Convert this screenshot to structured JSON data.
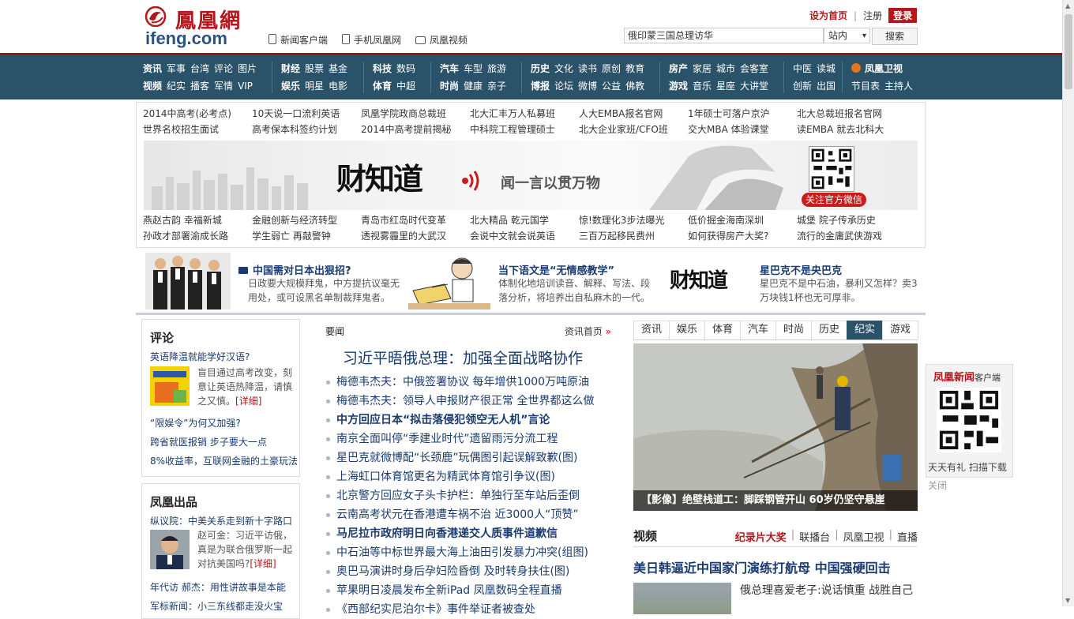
{
  "header": {
    "logo_cn": "鳳凰網",
    "logo_en": "ifeng.com",
    "top_links": [
      "新闻客户端",
      "手机凤凰网",
      "凤凰视频"
    ],
    "set_home": "设为首页",
    "register": "注册",
    "login": "登录",
    "search_value": "俄印蒙三国总理访华",
    "search_scope": "站内",
    "search_button": "搜索"
  },
  "nav": {
    "groups": [
      {
        "rows": [
          [
            "资讯",
            "军事",
            "台湾",
            "评论",
            "图片"
          ],
          [
            "视频",
            "纪实",
            "播客",
            "军情",
            "VIP"
          ]
        ]
      },
      {
        "rows": [
          [
            "财经",
            "股票",
            "基金"
          ],
          [
            "娱乐",
            "明星",
            "电影"
          ]
        ]
      },
      {
        "rows": [
          [
            "科技",
            "数码"
          ],
          [
            "体育",
            "中超"
          ]
        ]
      },
      {
        "rows": [
          [
            "汽车",
            "车型",
            "旅游"
          ],
          [
            "时尚",
            "健康",
            "亲子"
          ]
        ]
      },
      {
        "rows": [
          [
            "历史",
            "文化",
            "读书",
            "原创",
            "教育"
          ],
          [
            "博报",
            "论坛",
            "微博",
            "公益",
            "佛教"
          ]
        ]
      },
      {
        "rows": [
          [
            "房产",
            "家居",
            "城市",
            "会客室"
          ],
          [
            "游戏",
            "音乐",
            "星座",
            "大讲堂"
          ]
        ]
      },
      {
        "rows": [
          [
            "中医",
            "读城"
          ],
          [
            "创新",
            "出国"
          ]
        ]
      },
      {
        "rows": [
          [
            "凤凰卫视"
          ],
          [
            "节目表",
            "主持人"
          ]
        ]
      }
    ]
  },
  "ad": {
    "links_top": [
      "2014中高考(必考点)",
      "10天说一口流利英语",
      "凤凰学院政商总裁班",
      "北大汇丰万人私募班",
      "人大EMBA报名官网",
      "1年硕士可落户京沪",
      "北大总裁班报名官网",
      "世界名校招生面试",
      "高考保本科签约计划",
      "2014中高考提前揭秘",
      "中科院工程管理硕士",
      "北大企业家班/CFO班",
      "交大MBA 体验课堂",
      "读EMBA 就去北科大"
    ],
    "banner_logo": "财知道",
    "banner_slogan": "闻一言以贯万物",
    "banner_follow": "关注官方微信",
    "links_bottom": [
      "燕赵古韵 幸福新城",
      "金融创新与经济转型",
      "青岛市红岛时代变革",
      "北大精品 乾元国学",
      "惊!数理化3步法曝光",
      "低价掘金海南深圳",
      "城堡 院子传承历史",
      "孙政才部署渝成长路",
      "学生弱亡 再敲警钟",
      "透视雾霾里的大武汉",
      "会说中文就会说英语",
      "三百万起移民费州",
      "如何获得房产大奖?",
      "流行的金庸武侠游戏"
    ]
  },
  "features": [
    {
      "title": "中国需对日本出狠招?",
      "desc": "日政要大规模拜鬼，中方提抗议毫无用处，或可设黑名单制裁拜鬼者。"
    },
    {
      "title": "当下语文是“无情感教学”",
      "desc": "体制化地培训读音、解释、写法、段落分析，将培养出自私麻木的一代。"
    },
    {
      "title": "星巴克不是央巴克",
      "desc": "星巴克不是中石油，暴利又怎样？卖3万块钱1杯也无可厚非。"
    }
  ],
  "feature_logo": "财知道",
  "comment": {
    "title": "评论",
    "lead": "英语降温就能学好汉语?",
    "desc": "盲目通过高考改变，刻意让英语热降温，请慎之又慎。",
    "more": "[详细]",
    "links": [
      "“限娱令”为何又加强?",
      "跨省就医报销 步子要大一点",
      "8%收益率，互联网金融的土豪玩法"
    ]
  },
  "produce": {
    "title": "凤凰出品",
    "lead": "纵议院：中美关系走到新十字路口",
    "desc": "赵可金：习近平访俄，真是为联合俄罗斯一起对抗美国吗?",
    "more": "[详细]",
    "links": [
      "年代访 郝杰：用性讲故事是本能",
      "军标新闻：小三东线都走没火宝"
    ]
  },
  "center": {
    "tab_label": "要闻",
    "more_label": "资讯首页",
    "more_arrow": "»",
    "headline": "习近平晤俄总理：加强全面战略协作",
    "items": [
      {
        "text": "梅德韦杰夫：中俄签署协议 每年增供1000万吨原油",
        "bold": false
      },
      {
        "text": "梅德韦杰夫：领导人申报财产很正常 全世界都这么做",
        "bold": false
      },
      {
        "text": "中方回应日本“拟击落侵犯领空无人机”言论",
        "bold": true
      },
      {
        "text": "南京全面叫停“季建业时代”遗留雨污分流工程",
        "bold": false
      },
      {
        "text": "星巴克就微博配“长颈鹿”玩偶图引起误解致歉(图)",
        "bold": false
      },
      {
        "text": "上海虹口体育馆更名为精武体育馆引争议(图)",
        "bold": false
      },
      {
        "text": "北京警方回应女子头卡护栏：单独行至车站后歪倒",
        "bold": false
      },
      {
        "text": "云南高考状元在香港遭车祸不治 近3000人“顶赞”",
        "bold": false
      },
      {
        "text": "马尼拉市政府明日向香港递交人质事件道歉信",
        "bold": true
      },
      {
        "text": "中石油等中标世界最大海上油田引发暴力冲突(组图)",
        "bold": false
      },
      {
        "text": "奥巴马演讲时身后孕妇险昏倒 及时转身扶住(图)",
        "bold": false
      },
      {
        "text": "苹果明日凌晨发布全新iPad 凤凰数码全程直播",
        "bold": false
      },
      {
        "text": "《西部纪实尼泊尔卡》事件举证者被查处",
        "bold": false
      }
    ]
  },
  "right": {
    "tabs": [
      "资讯",
      "娱乐",
      "体育",
      "汽车",
      "时尚",
      "历史",
      "纪实",
      "游戏"
    ],
    "active_tab": "纪实",
    "photo_caption": "【影像】绝壁栈道工：脚踩钢管开山 60岁仍坚守悬崖",
    "video_title": "视频",
    "video_links": [
      "纪录片大奖",
      "联播台",
      "凤凰卫视",
      "直播"
    ],
    "video_headline": "美日韩逼近中国家门演练打航母 中国强硬回击",
    "video_text": "俄总理喜爱老子:说话慎重 战胜自己"
  },
  "float_qr": {
    "title": "凤凰新闻",
    "subtitle": "客户端",
    "caption": "天天有礼 扫描下载",
    "close": "关闭"
  },
  "colors": {
    "brand_red": "#b3161b",
    "nav_bg": "#2a5269",
    "link_blue": "#1a3b6e"
  }
}
